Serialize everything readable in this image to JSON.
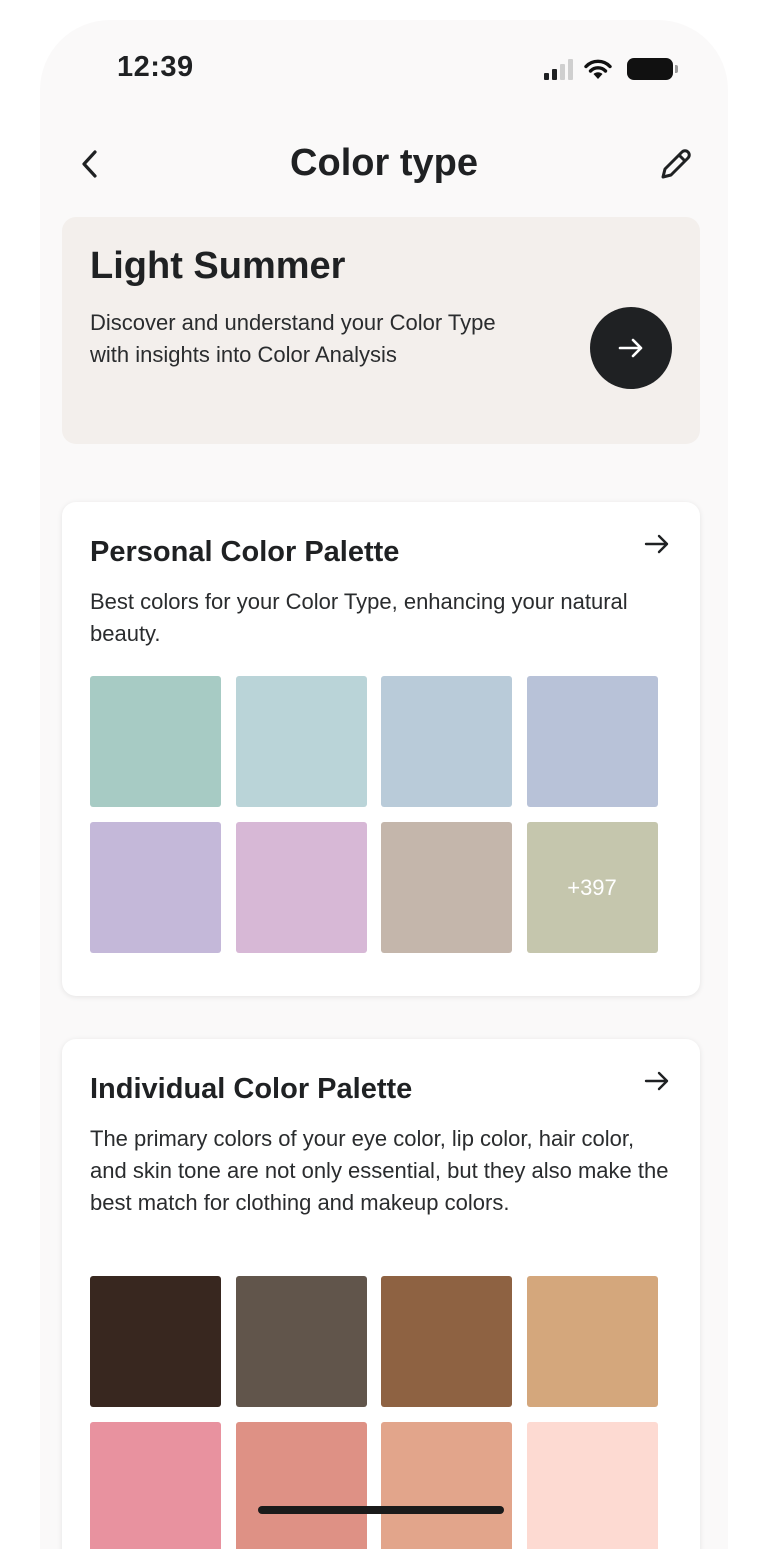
{
  "status_bar": {
    "time": "12:39"
  },
  "nav": {
    "title": "Color type"
  },
  "hero": {
    "title": "Light Summer",
    "description": "Discover and understand your Color Type with insights into Color Analysis"
  },
  "personal_palette": {
    "title": "Personal Color Palette",
    "description": "Best colors for your Color Type, enhancing your natural beauty.",
    "more_label": "+397",
    "swatches": [
      "#a7cbc4",
      "#bad4d8",
      "#b9cbd9",
      "#b8c2d8",
      "#c4b8d9",
      "#d7b8d6",
      "#c4b6ab",
      "#c5c6ad"
    ]
  },
  "individual_palette": {
    "title": "Individual Color Palette",
    "description": "The primary colors of your eye color, lip color, hair color, and skin tone are not only essential, but they also make the best match for clothing and makeup colors.",
    "swatches": [
      "#38271f",
      "#61554b",
      "#8e6242",
      "#d4a77c",
      "#e8929f",
      "#de9185",
      "#e2a58b",
      "#fddad2"
    ]
  }
}
